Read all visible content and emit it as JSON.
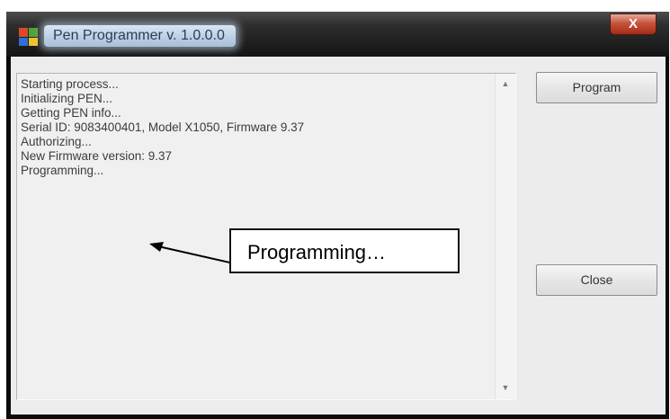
{
  "window": {
    "title": "Pen Programmer v. 1.0.0.0",
    "close_glyph": "X"
  },
  "log": {
    "lines": [
      "Starting process...",
      "Initializing PEN...",
      "Getting PEN info...",
      "Serial ID: 9083400401, Model X1050, Firmware 9.37",
      "Authorizing...",
      "New Firmware version: 9.37",
      "Programming..."
    ],
    "scroll_up_glyph": "▲",
    "scroll_down_glyph": "▼"
  },
  "buttons": {
    "program_label": "Program",
    "close_label": "Close"
  },
  "annotation": {
    "text": "Programming…"
  },
  "icons": {
    "app_icon": "pen-programmer-app-icon",
    "arrow": "left-arrow-icon"
  },
  "colors": {
    "titlebar": "#141414",
    "close_button": "#c6533a",
    "client_bg": "#ececec"
  }
}
